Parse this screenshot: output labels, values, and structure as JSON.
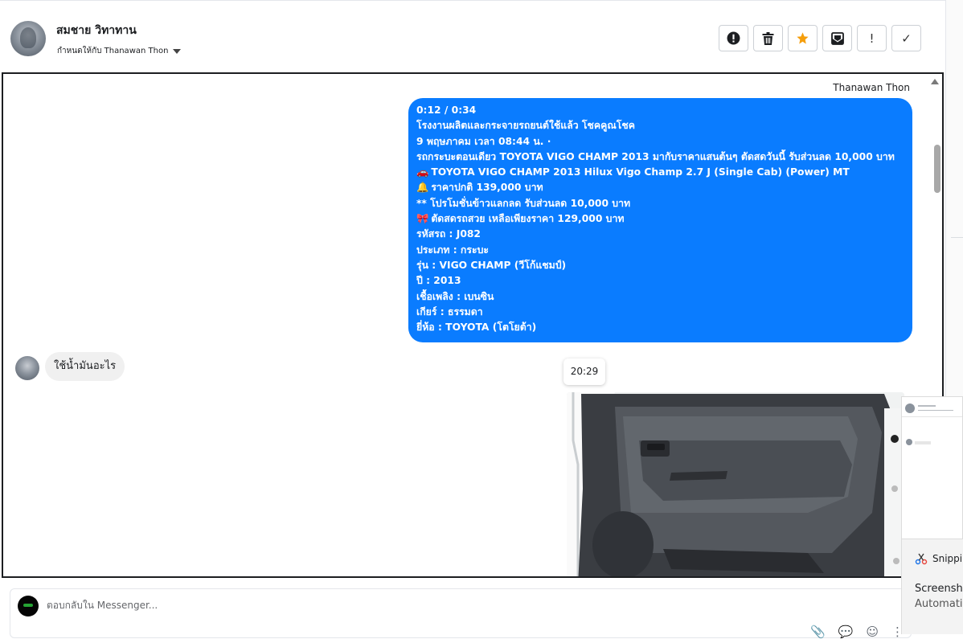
{
  "header": {
    "contact_name": "สมชาย วิทาทาน",
    "assigned_label": "กำหนดให้กับ Thanawan Thon",
    "toolbar": [
      {
        "name": "spam-button",
        "icon": "alert-circle-icon"
      },
      {
        "name": "delete-button",
        "icon": "trash-icon"
      },
      {
        "name": "star-button",
        "icon": "star-icon"
      },
      {
        "name": "mark-unread-button",
        "icon": "envelope-icon"
      },
      {
        "name": "important-button",
        "icon": "exclamation-icon",
        "label": "!"
      },
      {
        "name": "done-button",
        "icon": "check-icon",
        "label": "✓"
      }
    ],
    "accent_star_color": "#f59e0b"
  },
  "conversation": {
    "sender_label": "Thanawan Thon",
    "outgoing_lines": [
      {
        "text": "0:12 / 0:34"
      },
      {
        "text": "โรงงานผลิตและกระจายรถยนต์ใช้แล้ว โชคคูณโชค"
      },
      {
        "text": "9 พฤษภาคม เวลา 08:44 น.  ·"
      },
      {
        "text": "รถกระบะตอนเดียว TOYOTA VIGO CHAMP 2013 มากับราคาแสนต้นๆ ตัดสดวันนี้ รับส่วนลด 10,000 บาท"
      },
      {
        "emoji": "🚗",
        "text": "TOYOTA VIGO CHAMP 2013 Hilux Vigo Champ 2.7 J (Single Cab) (Power) MT"
      },
      {
        "emoji": "🔔",
        "text": "ราคาปกติ 139,000 บาท"
      },
      {
        "text": "** โปรโมชั่นข้าวแลกลด รับส่วนลด 10,000 บาท"
      },
      {
        "emoji": "🎀",
        "text": "ตัดสดรถสวย เหลือเพียงราคา 129,000 บาท"
      },
      {
        "text": "รหัสรถ : J082"
      },
      {
        "text": "ประเภท : กระบะ"
      },
      {
        "text": "รุ่น : VIGO CHAMP (วีโก้แชมป์)"
      },
      {
        "text": "ปี : 2013"
      },
      {
        "text": "เชื้อเพลิง : เบนซิน"
      },
      {
        "text": "เกียร์ : ธรรมดา"
      },
      {
        "text": "ยี่ห้อ : TOYOTA (โตโยต้า)"
      }
    ],
    "outgoing_color": "#0a7cff",
    "incoming_text": "ใช้น้ำมันอะไร",
    "time_chip": "20:29"
  },
  "compose": {
    "placeholder": "ตอบกลับใน Messenger..."
  },
  "notification": {
    "app_name": "Snipping Tool",
    "title": "Screenshot copied",
    "subtitle": "Automatically saved"
  }
}
